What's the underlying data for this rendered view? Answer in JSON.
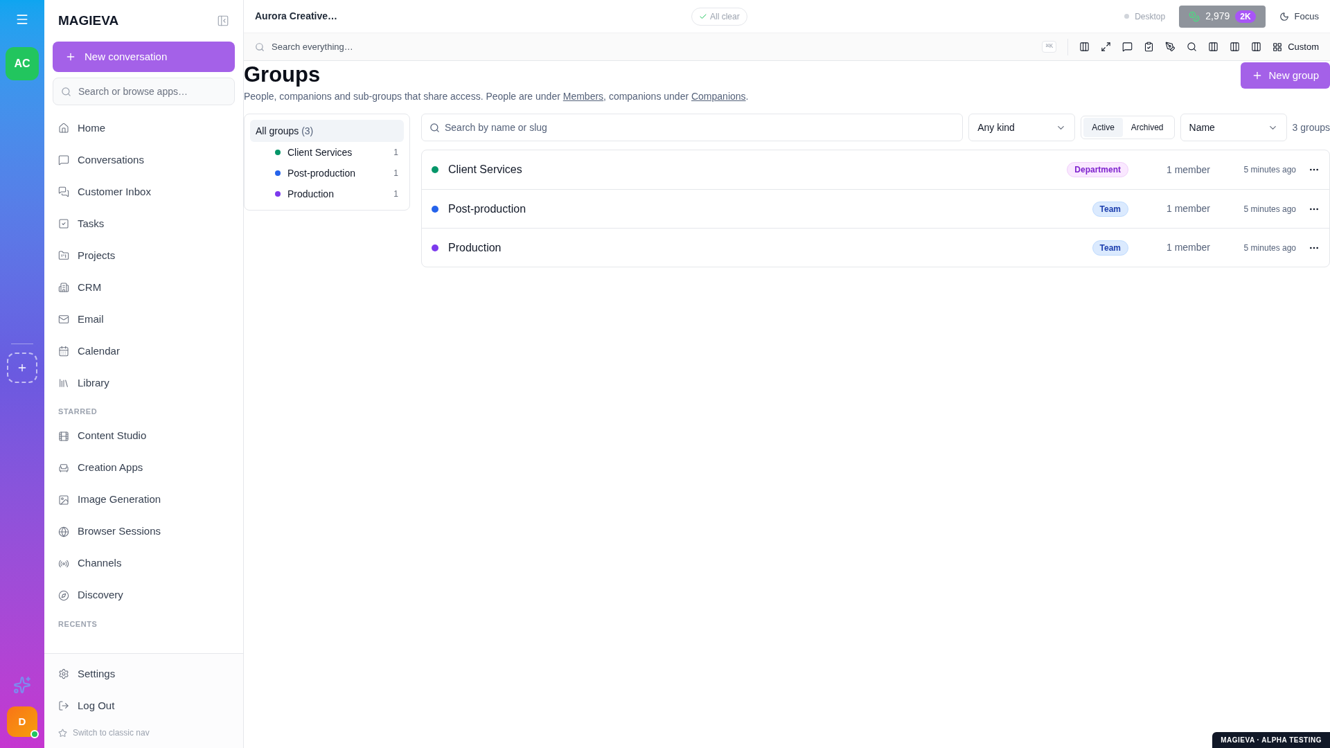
{
  "rail": {
    "workspace": "AC",
    "user": "D",
    "online": true
  },
  "sidebar": {
    "brand": "MAGIEVA",
    "new_button": "New conversation",
    "search_placeholder": "Search or browse apps…",
    "items": [
      {
        "label": "Home"
      },
      {
        "label": "Conversations"
      },
      {
        "label": "Customer Inbox"
      },
      {
        "label": "Tasks"
      },
      {
        "label": "Projects"
      },
      {
        "label": "CRM"
      },
      {
        "label": "Email"
      },
      {
        "label": "Calendar"
      },
      {
        "label": "Library"
      }
    ],
    "starred_heading": "STARRED",
    "starred": [
      {
        "label": "Content Studio"
      },
      {
        "label": "Creation Apps"
      },
      {
        "label": "Image Generation"
      },
      {
        "label": "Browser Sessions"
      },
      {
        "label": "Channels"
      },
      {
        "label": "Discovery"
      }
    ],
    "recents_heading": "RECENTS",
    "footer": [
      {
        "label": "Settings"
      },
      {
        "label": "Log Out"
      }
    ],
    "classic_nav": "Switch to classic nav"
  },
  "topbar": {
    "workspace": "Aurora Creative…",
    "status": "All clear",
    "device": "Desktop",
    "credits": "2,979",
    "credits_badge": "2K",
    "focus": "Focus"
  },
  "toolbar": {
    "search_placeholder": "Search everything…",
    "shortcut": "⌘K",
    "custom": "Custom"
  },
  "page": {
    "title": "Groups",
    "new_button": "New group",
    "description": [
      "People, companions and sub-groups that share access. People are under ",
      "Members",
      ", companions under ",
      "Companions",
      "."
    ]
  },
  "tree": {
    "label": "All groups",
    "count": "(3)",
    "selected": true,
    "children": [
      {
        "name": "Client Services",
        "color": "#059669",
        "count": "1"
      },
      {
        "name": "Post-production",
        "color": "#2563eb",
        "count": "1"
      },
      {
        "name": "Production",
        "color": "#7c3aed",
        "count": "1"
      }
    ]
  },
  "filters": {
    "search_placeholder": "Search by name or slug",
    "kind": "Any kind",
    "status_tabs": [
      {
        "label": "Active",
        "selected": true
      },
      {
        "label": "Archived",
        "selected": false
      }
    ],
    "sort": "Name",
    "total": "3 groups"
  },
  "groups": [
    {
      "name": "Client Services",
      "color": "#059669",
      "kind": "department",
      "tag": "Department",
      "members": "1 member",
      "updated": "5 minutes ago"
    },
    {
      "name": "Post-production",
      "color": "#2563eb",
      "kind": "team",
      "tag": "Team",
      "members": "1 member",
      "updated": "5 minutes ago"
    },
    {
      "name": "Production",
      "color": "#7c3aed",
      "kind": "team",
      "tag": "Team",
      "members": "1 member",
      "updated": "5 minutes ago"
    }
  ],
  "footer_badge": "MAGIEVA · ALPHA TESTING"
}
